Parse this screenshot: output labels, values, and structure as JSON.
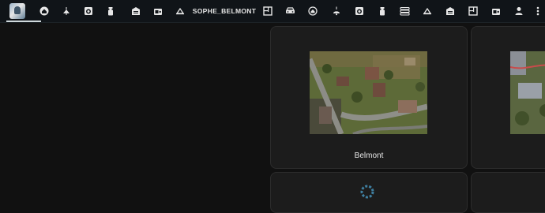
{
  "topbar": {
    "title": "SOPHE_BELMONT",
    "tabs_left": [
      "avatar",
      "home-icon",
      "ceiling-light-icon",
      "washing-machine-icon",
      "spray-bottle-icon",
      "garage-icon",
      "radio-icon",
      "wall-lamp-icon"
    ],
    "tabs_right": [
      "floor-plan-icon",
      "car-icon",
      "home-circle-icon",
      "pendant-lamp-icon",
      "washing-machine-icon",
      "spray-bottle-icon",
      "heater-icon",
      "wall-lamp-icon",
      "garage-icon",
      "floor-plan-icon",
      "radio-icon",
      "person-icon",
      "more-icon"
    ]
  },
  "cards": [
    {
      "label": "Belmont"
    }
  ]
}
